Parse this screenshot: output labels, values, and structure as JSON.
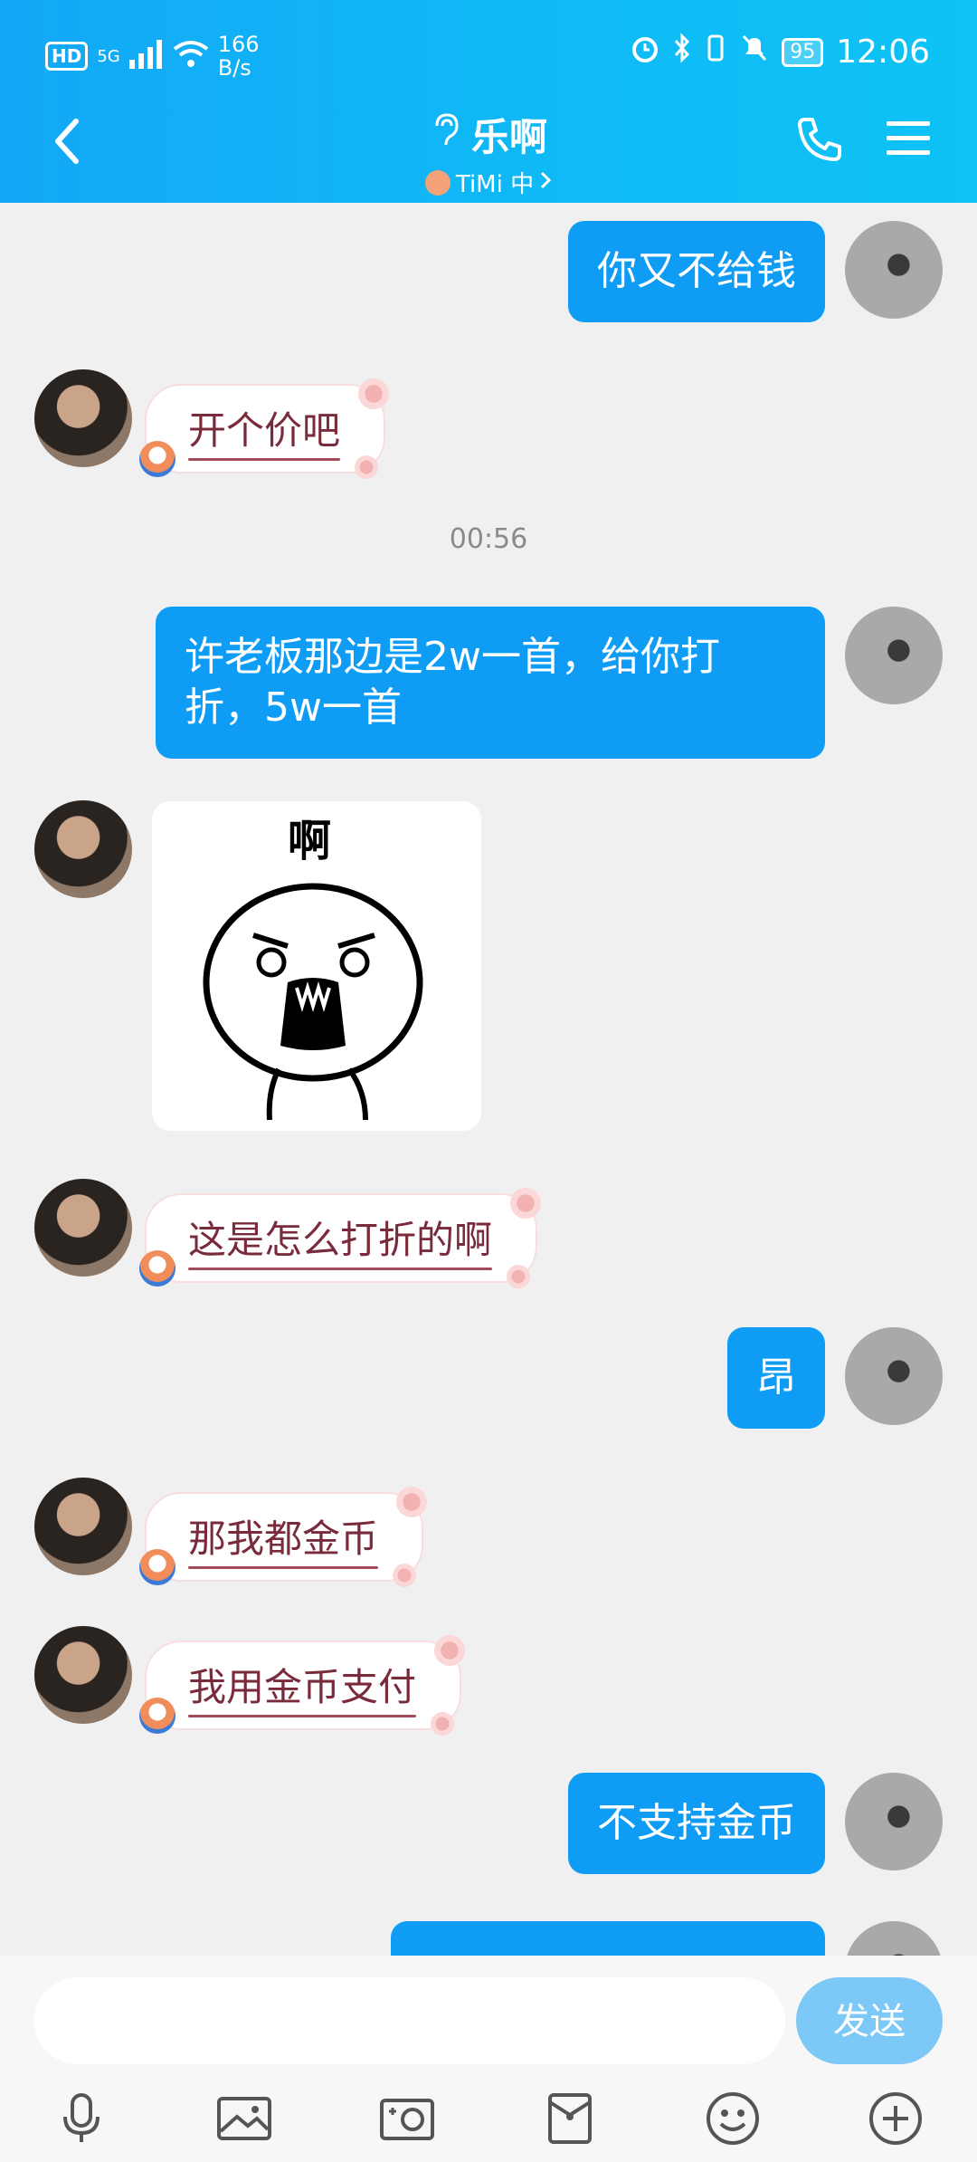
{
  "status_bar": {
    "hd": "HD",
    "signal": "5G",
    "net_speed_value": "166",
    "net_speed_unit": "B/s",
    "battery": "95",
    "time": "12:06"
  },
  "header": {
    "title": "乐啊",
    "subtitle": "TiMi 中",
    "icons": [
      "back-icon",
      "ear-icon",
      "phone-icon",
      "menu-icon"
    ]
  },
  "messages": [
    {
      "side": "out",
      "text": "你又不给钱"
    },
    {
      "side": "in",
      "text": "开个价吧"
    },
    {
      "type": "time",
      "text": "00:56"
    },
    {
      "side": "out",
      "text": "许老板那边是2w一首，给你打折，5w一首"
    },
    {
      "side": "in",
      "type": "sticker",
      "text": "啊"
    },
    {
      "side": "in",
      "text": "这是怎么打折的啊"
    },
    {
      "side": "out",
      "text": "昂"
    },
    {
      "side": "in",
      "text": "那我都金币"
    },
    {
      "side": "in",
      "text": "我用金币支付"
    },
    {
      "side": "out",
      "text": "不支持金币"
    }
  ],
  "input_bar": {
    "placeholder": "",
    "send_label": "发送",
    "tools": [
      "microphone-icon",
      "image-icon",
      "camera-icon",
      "red-packet-icon",
      "emoji-icon",
      "plus-icon"
    ]
  },
  "colors": {
    "header": "#13a8f6",
    "bubble_out": "#0f9cf5",
    "bubble_in_text": "#7a2b3b",
    "send_button": "#7cc8f6",
    "background": "#f0f0f0"
  }
}
